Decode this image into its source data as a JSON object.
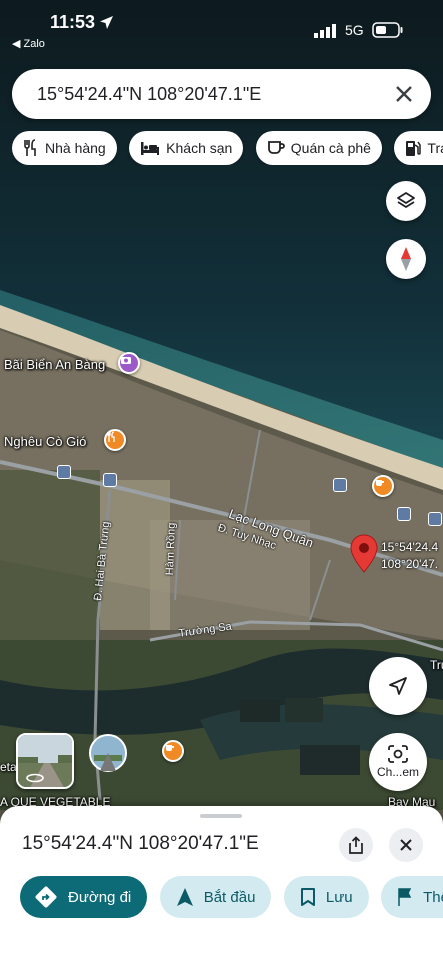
{
  "status_bar": {
    "time": "11:53",
    "back_app": "Zalo",
    "network": "5G"
  },
  "search": {
    "query": "15°54'24.4\"N 108°20'47.1\"E"
  },
  "chips": [
    {
      "label": "Nhà hàng",
      "icon": "fork-knife-icon"
    },
    {
      "label": "Khách sạn",
      "icon": "bed-icon"
    },
    {
      "label": "Quán cà phê",
      "icon": "coffee-cup-icon"
    },
    {
      "label": "Trạ",
      "icon": "gas-pump-icon"
    }
  ],
  "map": {
    "places": {
      "beach": "Bãi Biển An Bàng",
      "restaurant": "Nghêu Cò Gió",
      "farm": "A QUE VEGETABLE",
      "bay_mau": "Bay Mau",
      "left_edge": "eta",
      "right_edge": "Trư"
    },
    "roads": {
      "lac_long_quan": "Lạc Long Quân",
      "tuy_nhac": "Đ. Tuy Nhạc",
      "hai_ba_trung": "Đ. Hai Bà Trưng",
      "ham_rong": "Hàm Rồng",
      "truong_sa": "Trường Sa"
    },
    "dropped_pin": {
      "lat": "15°54'24.4",
      "lng": "108°20'47."
    },
    "lens_label": "Ch...em",
    "accent_red": "#e53935",
    "poi_purple": "#9c5ac9",
    "poi_orange": "#f08a24"
  },
  "sheet": {
    "title": "15°54'24.4\"N 108°20'47.1\"E",
    "actions": [
      {
        "label": "Đường đi",
        "icon": "directions-icon"
      },
      {
        "label": "Bắt đầu",
        "icon": "navigation-arrow-icon"
      },
      {
        "label": "Lưu",
        "icon": "bookmark-icon"
      },
      {
        "label": "Thên",
        "icon": "flag-icon"
      }
    ],
    "accent": "#0d6b77"
  }
}
